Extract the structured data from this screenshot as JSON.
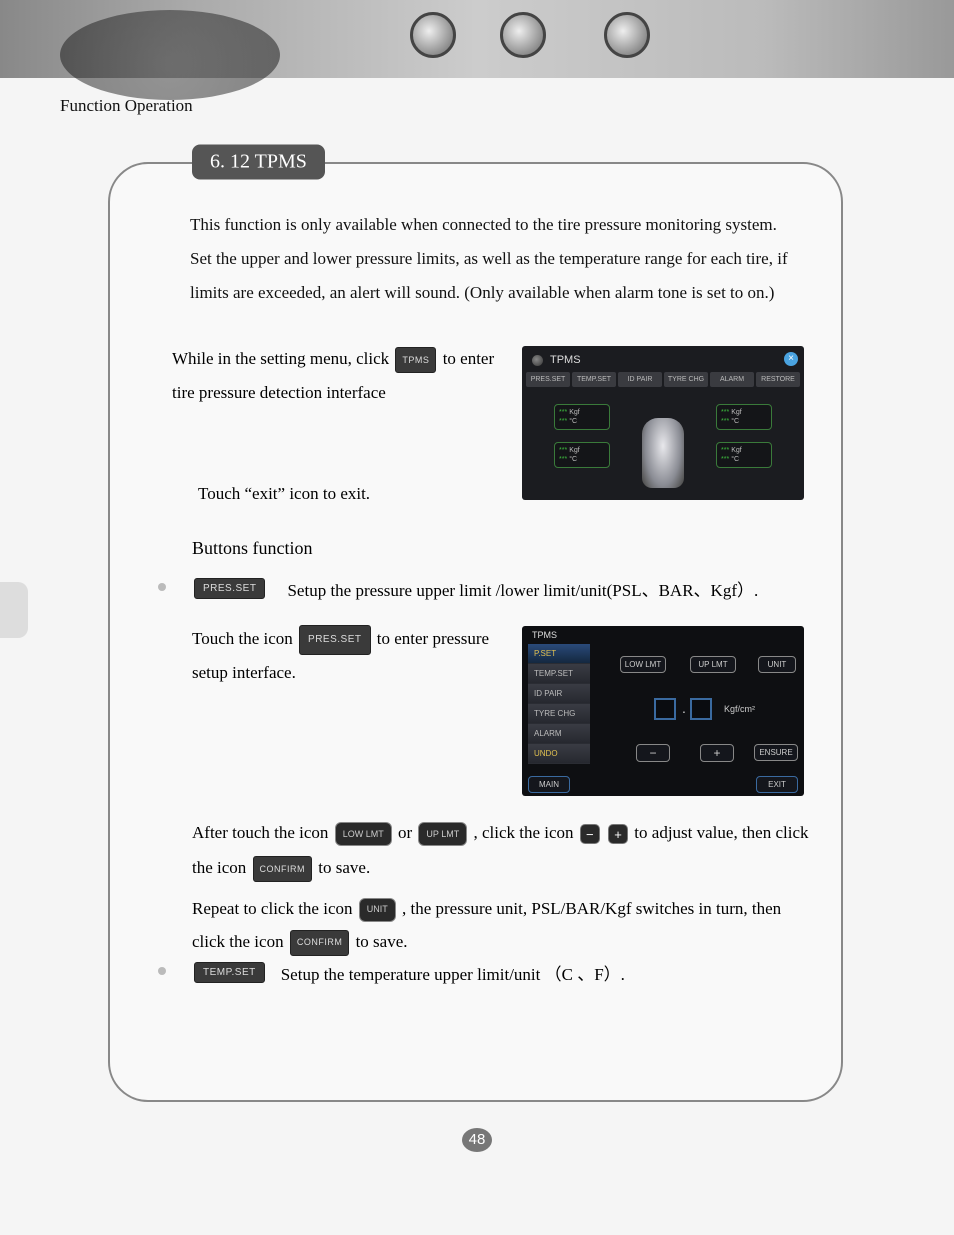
{
  "header": "Function  Operation",
  "section_title": "6. 12   TPMS",
  "intro": "This function is only available when connected to the tire pressure monitoring system. Set the upper and lower pressure limits, as well as the temperature range for each tire, if limits are exceeded, an alert will sound. (Only available when alarm tone is set to on.)",
  "para1_a": "While in the setting menu, click ",
  "para1_b": " to enter tire pressure detection interface",
  "para_exit": "Touch  “exit” icon to exit.",
  "buttons_heading": "Buttons function",
  "pres_desc": "Setup the pressure upper limit /lower limit/unit(PSL、BAR、Kgf）.",
  "pres_enter_a": "Touch the icon ",
  "pres_enter_b": " to enter pressure setup interface.",
  "after_a": "After touch the icon ",
  "after_b": " or ",
  "after_c": ", click the icon ",
  "after_d": " to adjust value, then click  the icon ",
  "after_e": " to save.",
  "repeat_a": "Repeat to click the icon ",
  "repeat_b": " , the pressure unit, PSL/BAR/Kgf switches in turn, then click the icon",
  "repeat_c": " to save.",
  "temp_desc": "Setup the temperature upper limit/unit （C 、F）.",
  "icons": {
    "tpms": "TPMS",
    "presset": "PRES.SET",
    "tempset": "TEMP.SET",
    "lowlmt": "LOW LMT",
    "uplmt": "UP LMT",
    "unit": "UNIT",
    "confirm": "CONFIRM",
    "minus": "−",
    "plus": "+"
  },
  "shot1": {
    "title": "TPMS",
    "tabs": [
      "PRES.SET",
      "TEMP.SET",
      "ID PAIR",
      "TYRE CHG",
      "ALARM",
      "RESTORE"
    ],
    "tire": {
      "val": "***",
      "u1": "Kgf",
      "u2": "°C"
    }
  },
  "shot2": {
    "title": "TPMS",
    "menu": [
      "P.SET",
      "TEMP.SET",
      "ID PAIR",
      "TYRE CHG",
      "ALARM",
      "UNDO"
    ],
    "top": [
      "LOW LMT",
      "UP LMT",
      "UNIT"
    ],
    "unit_label": "Kgf/cm²",
    "bottom": {
      "minus": "−",
      "plus": "+",
      "ensure": "ENSURE"
    },
    "footer": {
      "main": "MAIN",
      "exit": "EXIT"
    }
  },
  "page_number": "48"
}
